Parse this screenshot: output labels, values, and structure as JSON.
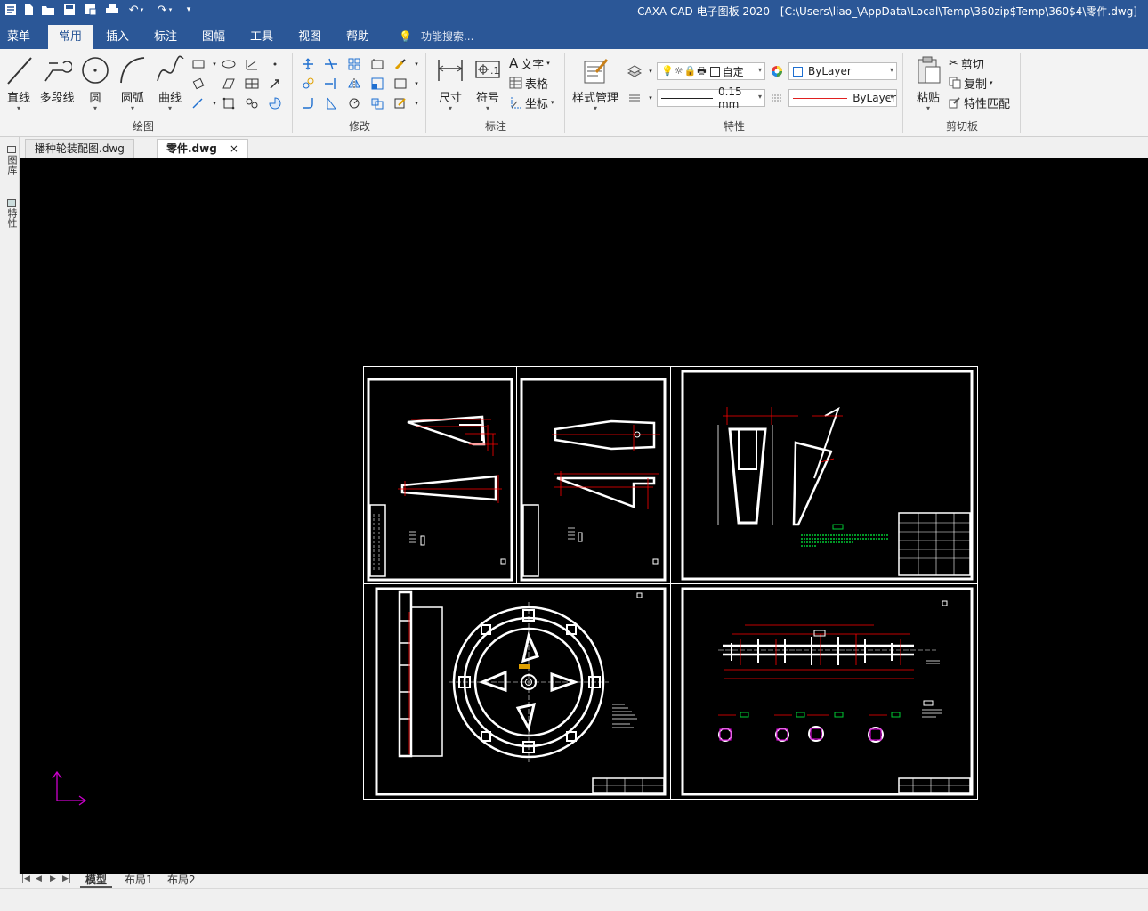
{
  "window": {
    "title": "CAXA CAD 电子图板 2020 - [C:\\Users\\liao_\\AppData\\Local\\Temp\\360zip$Temp\\360$4\\零件.dwg]"
  },
  "menu": {
    "tabs": [
      {
        "label": "菜单"
      },
      {
        "label": "常用"
      },
      {
        "label": "插入"
      },
      {
        "label": "标注"
      },
      {
        "label": "图幅"
      },
      {
        "label": "工具"
      },
      {
        "label": "视图"
      },
      {
        "label": "帮助"
      }
    ],
    "search_placeholder": "功能搜索..."
  },
  "ribbon": {
    "draw": {
      "label": "绘图",
      "line": "直线",
      "polyline": "多段线",
      "circle": "圆",
      "arc": "圆弧",
      "curve": "曲线"
    },
    "modify": {
      "label": "修改"
    },
    "annotate": {
      "label": "标注",
      "dimension": "尺寸",
      "symbol": "符号",
      "text": "文字",
      "table": "表格",
      "coordinate": "坐标"
    },
    "properties": {
      "label": "特性",
      "style_manager": "样式管理",
      "layer_value": "自定",
      "linewidth": "0.15 mm",
      "color": "ByLayer",
      "linetype": "ByLayer"
    },
    "clipboard": {
      "label": "剪切板",
      "paste": "粘贴",
      "cut": "剪切",
      "copy": "复制",
      "match": "特性匹配"
    }
  },
  "doc_tabs": [
    {
      "label": "播种轮装配图.dwg"
    },
    {
      "label": "零件.dwg"
    }
  ],
  "left_panel": {
    "tabs": [
      {
        "label": "图库"
      },
      {
        "label": "特性"
      }
    ]
  },
  "layout_tabs": [
    {
      "label": "模型"
    },
    {
      "label": "布局1"
    },
    {
      "label": "布局2"
    }
  ],
  "colors": {
    "title_bar": "#2b5797",
    "canvas": "#000000",
    "drawing_white": "#ffffff",
    "dimension_red": "#ff0000",
    "note_green": "#00cc33",
    "ucs_magenta": "#cc00cc"
  }
}
